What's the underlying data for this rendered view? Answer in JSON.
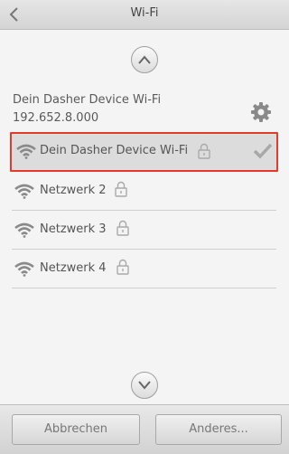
{
  "window": {
    "title": "Wi-Fi"
  },
  "device": {
    "name": "Dein Dasher Device Wi-Fi",
    "ip": "192.652.8.000"
  },
  "networks": [
    {
      "label": "Dein Dasher Device Wi-Fi",
      "secured": true,
      "connected": true
    },
    {
      "label": "Netzwerk 2",
      "secured": true,
      "connected": false
    },
    {
      "label": "Netzwerk 3",
      "secured": true,
      "connected": false
    },
    {
      "label": "Netzwerk 4",
      "secured": true,
      "connected": false
    }
  ],
  "footer": {
    "cancel_label": "Abbrechen",
    "other_label": "Anderes..."
  },
  "colors": {
    "selection_border": "#e53a2b",
    "icon": "#8a8a8a"
  },
  "icons": {
    "back": "chevron-left-icon",
    "scroll_up": "chevron-up-icon",
    "scroll_down": "chevron-down-icon",
    "settings": "gear-icon",
    "wifi": "wifi-icon",
    "lock": "lock-icon",
    "check": "check-icon"
  }
}
